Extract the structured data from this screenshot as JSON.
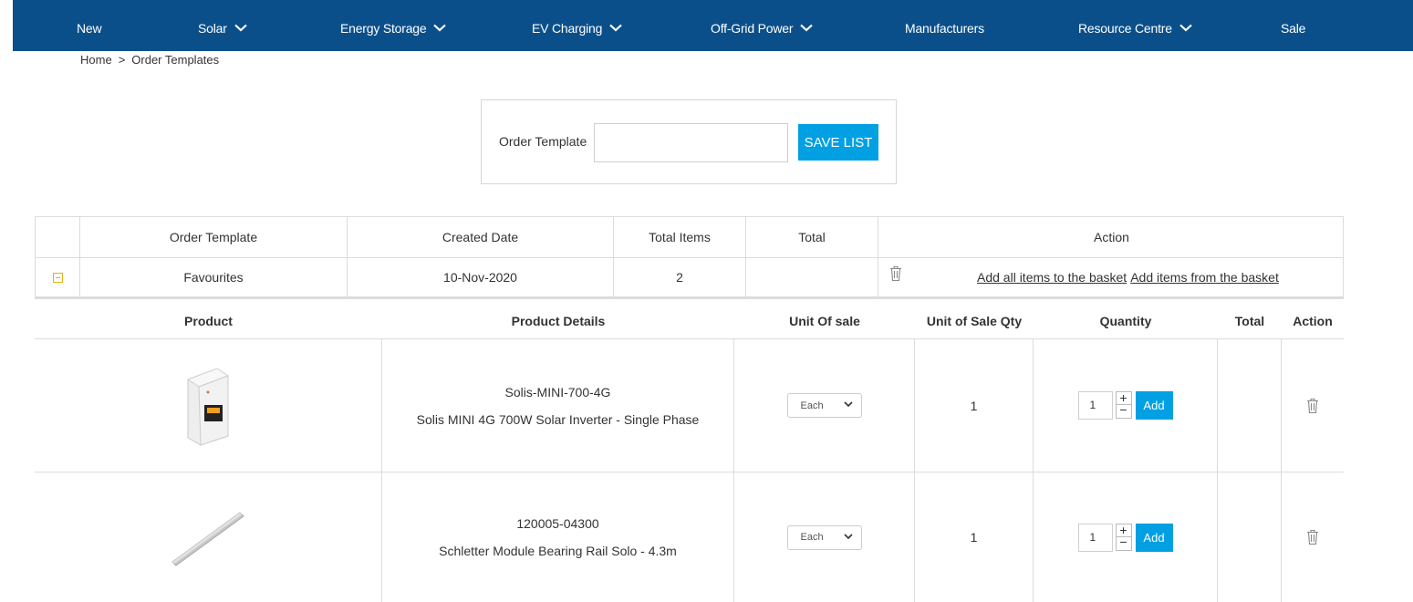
{
  "nav": {
    "items": [
      {
        "label": "New",
        "dropdown": false
      },
      {
        "label": "Solar",
        "dropdown": true
      },
      {
        "label": "Energy Storage",
        "dropdown": true
      },
      {
        "label": "EV Charging",
        "dropdown": true
      },
      {
        "label": "Off-Grid Power",
        "dropdown": true
      },
      {
        "label": "Manufacturers",
        "dropdown": false
      },
      {
        "label": "Resource Centre",
        "dropdown": true
      },
      {
        "label": "Sale",
        "dropdown": false
      }
    ]
  },
  "breadcrumb": {
    "home": "Home",
    "separator": ">",
    "current": "Order Templates"
  },
  "save_form": {
    "label": "Order Template",
    "value": "",
    "placeholder": "",
    "button": "SAVE LIST"
  },
  "templates": {
    "headers": [
      "Order Template",
      "Created Date",
      "Total Items",
      "Total",
      "Action"
    ],
    "rows": [
      {
        "name": "Favourites",
        "created": "10-Nov-2020",
        "total_items": "2",
        "total": "",
        "add_all_link": "Add all items to the basket",
        "add_from_link": "Add items from the basket"
      }
    ]
  },
  "products": {
    "headers": [
      "Product",
      "Product Details",
      "Unit Of sale",
      "Unit of Sale Qty",
      "Quantity",
      "Total",
      "Action"
    ],
    "rows": [
      {
        "code": "Solis-MINI-700-4G",
        "name": "Solis MINI 4G 700W Solar Inverter - Single Phase",
        "unit": "Each",
        "unit_qty": "1",
        "quantity": "1",
        "total": "",
        "add_label": "Add",
        "image_icon": "inverter-image"
      },
      {
        "code": "120005-04300",
        "name": "Schletter Module Bearing Rail Solo - 4.3m",
        "unit": "Each",
        "unit_qty": "1",
        "quantity": "1",
        "total": "",
        "add_label": "Add",
        "image_icon": "rail-image"
      }
    ]
  },
  "colors": {
    "nav_bg": "#0b4f8a",
    "accent": "#00a0e3",
    "expand": "#e8b10e"
  }
}
